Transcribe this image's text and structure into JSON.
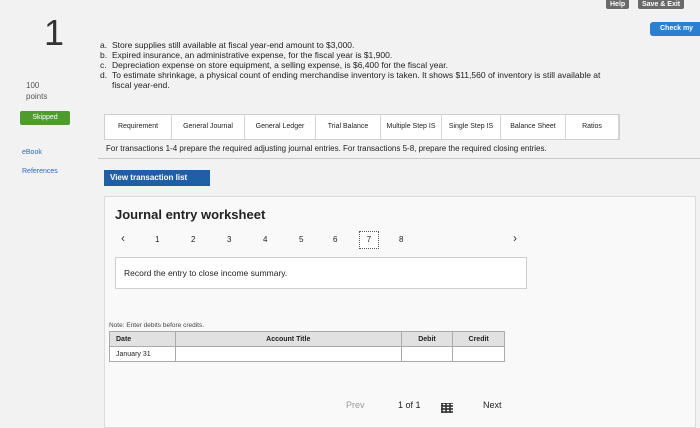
{
  "top": {
    "help": "Help",
    "save_exit": "Save & Exit",
    "check": "Check my"
  },
  "question": {
    "number": "1",
    "points_value": "100",
    "points_label": "points"
  },
  "sidebar": {
    "status": "Skipped",
    "ebook": "eBook",
    "references": "References"
  },
  "items": [
    {
      "label": "a.",
      "text": "Store supplies still available at fiscal year-end amount to $3,000."
    },
    {
      "label": "b.",
      "text": "Expired insurance, an administrative expense, for the fiscal year is $1,900."
    },
    {
      "label": "c.",
      "text": "Depreciation expense on store equipment, a selling expense, is $6,400 for the fiscal year."
    },
    {
      "label": "d.",
      "text": "To estimate shrinkage, a physical count of ending merchandise inventory is taken. It shows $11,560 of inventory is still available at"
    },
    {
      "label": "",
      "text": "fiscal year-end."
    }
  ],
  "tabs": [
    "Requirement",
    "General Journal",
    "General Ledger",
    "Trial Balance",
    "Multiple Step IS",
    "Single Step IS",
    "Balance Sheet",
    "Ratios"
  ],
  "instruction": "For transactions 1-4 prepare the required adjusting journal entries. For transactions 5-8, prepare the required closing entries.",
  "view_transaction": "View transaction list",
  "worksheet": {
    "title": "Journal entry worksheet",
    "pages": [
      "1",
      "2",
      "3",
      "4",
      "5",
      "6",
      "7",
      "8"
    ],
    "active_page": "7",
    "task": "Record the entry to close income summary.",
    "note": "Note: Enter debits before credits.",
    "columns": [
      "Date",
      "Account Title",
      "Debit",
      "Credit"
    ],
    "rows": [
      [
        "January 31",
        "",
        "",
        ""
      ]
    ]
  },
  "footer": {
    "prev": "Prev",
    "page_of": "1 of 1",
    "next": "Next"
  }
}
